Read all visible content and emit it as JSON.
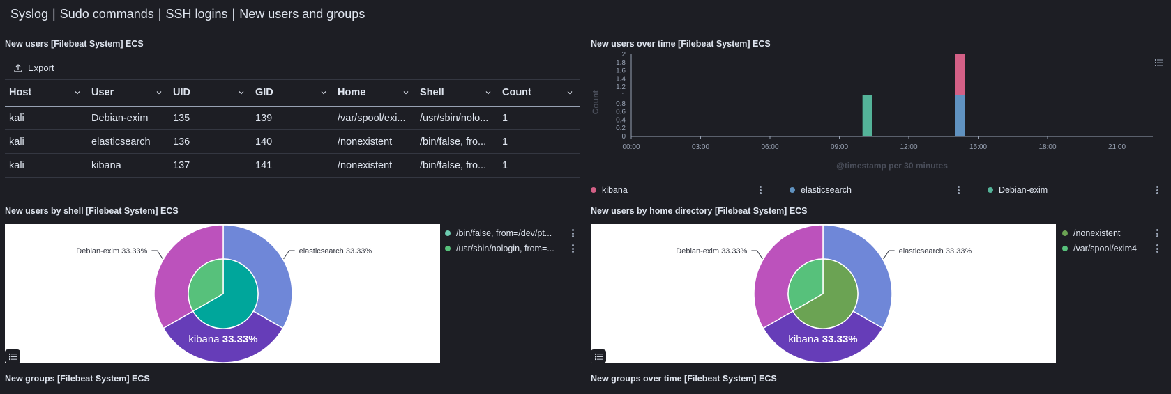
{
  "nav": {
    "links": [
      "Syslog",
      "Sudo commands",
      "SSH logins",
      "New users and groups"
    ],
    "sep": "|"
  },
  "panels": {
    "users_table_title": "New users [Filebeat System] ECS",
    "users_time_title": "New users over time [Filebeat System] ECS",
    "users_shell_title": "New users by shell [Filebeat System] ECS",
    "users_home_title": "New users by home directory [Filebeat System] ECS",
    "groups_table_title": "New groups [Filebeat System] ECS",
    "groups_time_title": "New groups over time [Filebeat System] ECS"
  },
  "table": {
    "export_label": "Export",
    "columns": [
      "Host",
      "User",
      "UID",
      "GID",
      "Home",
      "Shell",
      "Count"
    ],
    "rows": [
      [
        "kali",
        "Debian-exim",
        "135",
        "139",
        "/var/spool/exi...",
        "/usr/sbin/nolo...",
        "1"
      ],
      [
        "kali",
        "elasticsearch",
        "136",
        "140",
        "/nonexistent",
        "/bin/false, fro...",
        "1"
      ],
      [
        "kali",
        "kibana",
        "137",
        "141",
        "/nonexistent",
        "/bin/false, fro...",
        "1"
      ]
    ]
  },
  "colors": {
    "kibana": "#d36086",
    "elasticsearch": "#6092c0",
    "debian_exim": "#54b399",
    "pie_outer_elastic": "#6f87d8",
    "pie_outer_kibana": "#663db8",
    "pie_outer_debian": "#bc52bc",
    "pie_inner_teal": "#00a69b",
    "pie_inner_green": "#57c17b",
    "pie_inner_olive": "#6ba353",
    "legend_cyan": "#6dccb1"
  },
  "chart_data": [
    {
      "type": "bar",
      "title": "",
      "xlabel": "@timestamp per 30 minutes",
      "ylabel": "Count",
      "x_ticks": [
        "00:00",
        "03:00",
        "06:00",
        "09:00",
        "12:00",
        "15:00",
        "18:00",
        "21:00"
      ],
      "y_ticks": [
        "0",
        "0.2",
        "0.4",
        "0.6",
        "0.8",
        "1",
        "1.2",
        "1.4",
        "1.6",
        "1.8",
        "2"
      ],
      "ylim": [
        0,
        2
      ],
      "stacked": true,
      "series": [
        {
          "name": "kibana",
          "points": [
            {
              "x": "14:00",
              "y": 1
            }
          ]
        },
        {
          "name": "elasticsearch",
          "points": [
            {
              "x": "14:00",
              "y": 1
            }
          ]
        },
        {
          "name": "Debian-exim",
          "points": [
            {
              "x": "10:00",
              "y": 1
            }
          ]
        }
      ],
      "legend": [
        "kibana",
        "elasticsearch",
        "Debian-exim"
      ],
      "legend_position": "bottom"
    },
    {
      "type": "pie",
      "donut": true,
      "outer_slices": [
        {
          "label": "elasticsearch",
          "value": 33.33,
          "text": "33.33%"
        },
        {
          "label": "kibana",
          "value": 33.33,
          "text": "33.33%"
        },
        {
          "label": "Debian-exim",
          "value": 33.33,
          "text": "33.33%"
        }
      ],
      "inner_slices": [
        {
          "label": "/bin/false, from=/dev/pt...",
          "value": 66.67
        },
        {
          "label": "/usr/sbin/nologin, from=...",
          "value": 33.33
        }
      ],
      "legend": [
        "/bin/false, from=/dev/pt...",
        "/usr/sbin/nologin, from=..."
      ],
      "legend_position": "right"
    },
    {
      "type": "pie",
      "donut": true,
      "outer_slices": [
        {
          "label": "elasticsearch",
          "value": 33.33,
          "text": "33.33%"
        },
        {
          "label": "kibana",
          "value": 33.33,
          "text": "33.33%"
        },
        {
          "label": "Debian-exim",
          "value": 33.33,
          "text": "33.33%"
        }
      ],
      "inner_slices": [
        {
          "label": "/nonexistent",
          "value": 66.67
        },
        {
          "label": "/var/spool/exim4",
          "value": 33.33
        }
      ],
      "legend": [
        "/nonexistent",
        "/var/spool/exim4"
      ],
      "legend_position": "right"
    }
  ]
}
